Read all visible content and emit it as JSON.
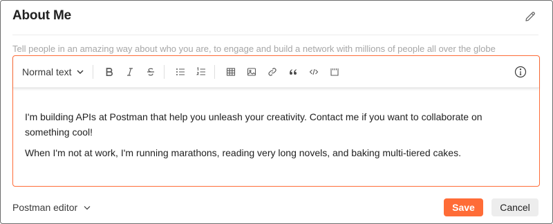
{
  "header": {
    "title": "About Me",
    "edit_icon": "pencil-icon"
  },
  "hint": "Tell people in an amazing way about who you are, to engage and build a network with millions of people all over the globe",
  "toolbar": {
    "text_style": "Normal text",
    "buttons": [
      "bold-icon",
      "italic-icon",
      "strikethrough-icon",
      "bullet-list-icon",
      "numbered-list-icon",
      "table-icon",
      "image-icon",
      "link-icon",
      "quote-icon",
      "code-icon",
      "code-block-icon",
      "info-icon"
    ]
  },
  "content": {
    "paragraphs": [
      "I'm building APIs at Postman that help you unleash your creativity. Contact me if you want to collaborate on something cool!",
      "When I'm not at work, I'm running marathons, reading very long novels, and baking multi-tiered cakes."
    ]
  },
  "footer": {
    "editor_mode": "Postman editor",
    "save_label": "Save",
    "cancel_label": "Cancel"
  },
  "colors": {
    "accent": "#ff6c37",
    "hint": "#a6a6a6",
    "cancel_bg": "#ededed"
  }
}
